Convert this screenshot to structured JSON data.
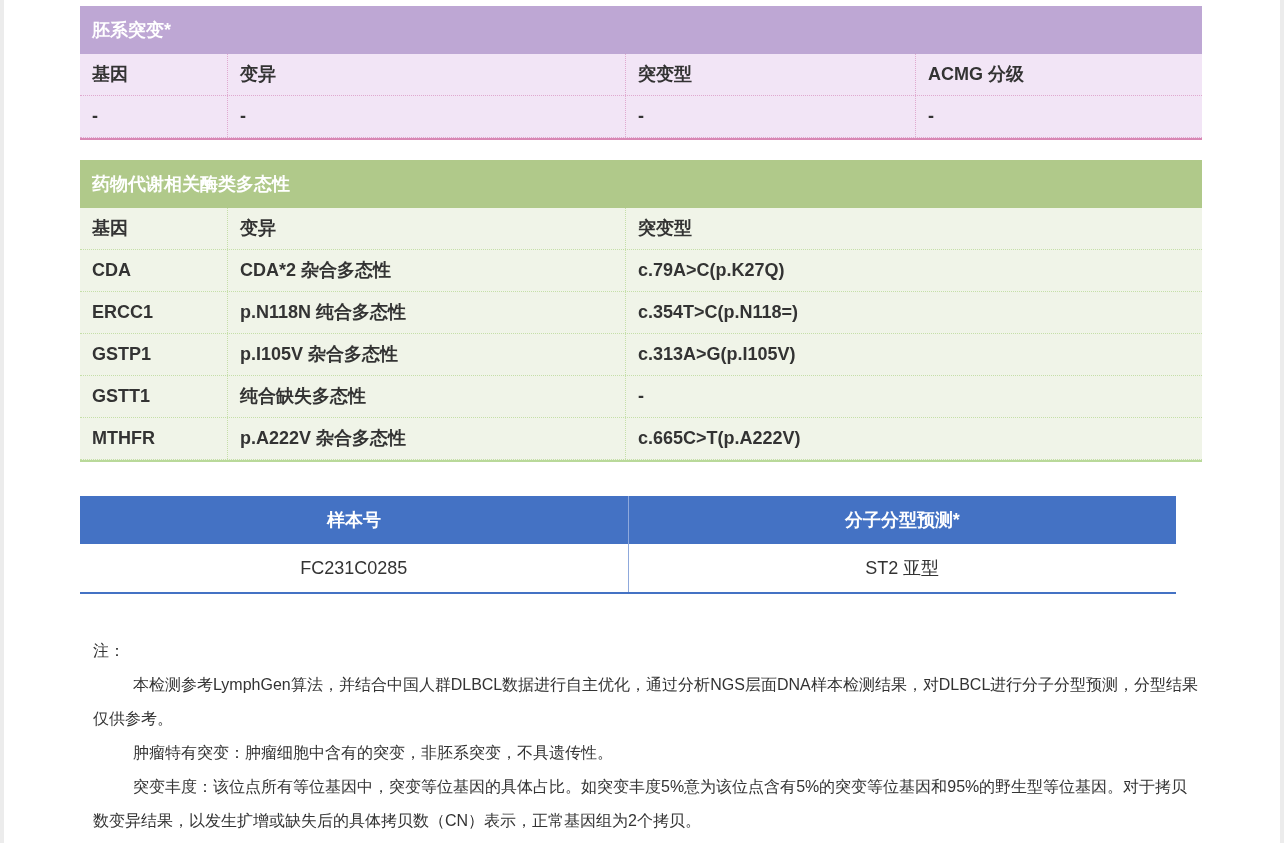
{
  "germline_table": {
    "title": "胚系突变*",
    "columns": [
      "基因",
      "变异",
      "突变型",
      "ACMG 分级"
    ],
    "rows": [
      [
        "-",
        "-",
        "-",
        "-"
      ]
    ]
  },
  "drug_table": {
    "title": "药物代谢相关酶类多态性",
    "columns": [
      "基因",
      "变异",
      "突变型"
    ],
    "rows": [
      [
        "CDA",
        "CDA*2 杂合多态性",
        "c.79A>C(p.K27Q)"
      ],
      [
        "ERCC1",
        "p.N118N 纯合多态性",
        "c.354T>C(p.N118=)"
      ],
      [
        "GSTP1",
        "p.I105V 杂合多态性",
        "c.313A>G(p.I105V)"
      ],
      [
        "GSTT1",
        "纯合缺失多态性",
        "-"
      ],
      [
        "MTHFR",
        "p.A222V 杂合多态性",
        "c.665C>T(p.A222V)"
      ]
    ]
  },
  "subtype_table": {
    "columns": [
      "样本号",
      "分子分型预测*"
    ],
    "rows": [
      [
        "FC231C0285",
        "ST2 亚型"
      ]
    ]
  },
  "notes": {
    "label": "注：",
    "paragraphs": [
      "本检测参考LymphGen算法，并结合中国人群DLBCL数据进行自主优化，通过分析NGS层面DNA样本检测结果，对DLBCL进行分子分型预测，分型结果仅供参考。",
      "肿瘤特有突变：肿瘤细胞中含有的突变，非胚系突变，不具遗传性。",
      "突变丰度：该位点所有等位基因中，突变等位基因的具体占比。如突变丰度5%意为该位点含有5%的突变等位基因和95%的野生型等位基因。对于拷贝数变异结果，以发生扩增或缺失后的具体拷贝数（CN）表示，正常基因组为2个拷贝。"
    ]
  }
}
